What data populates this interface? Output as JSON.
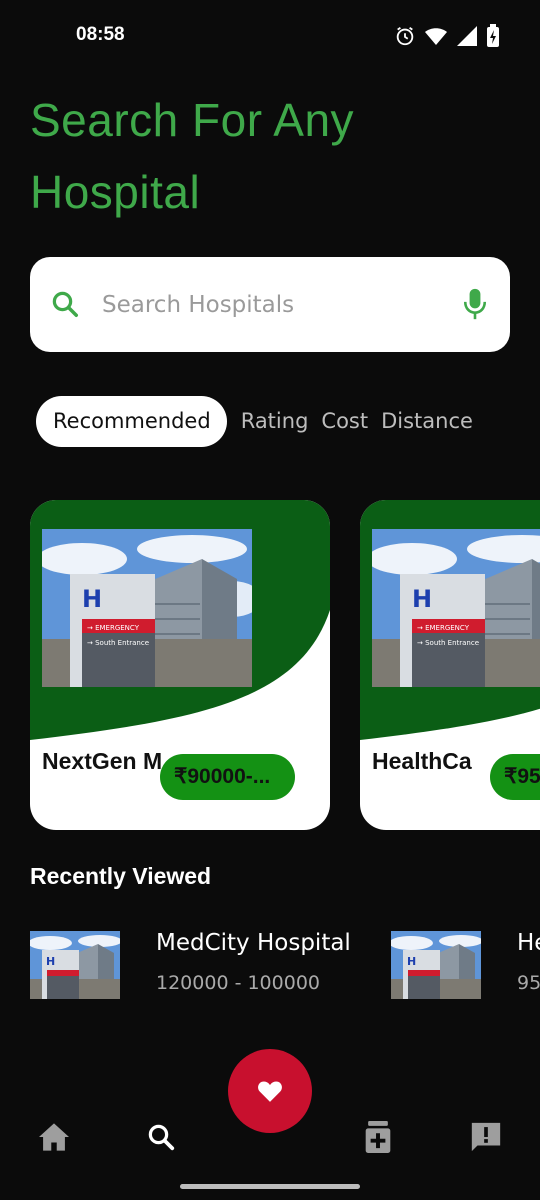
{
  "status_bar": {
    "time": "08:58"
  },
  "header": {
    "title": "Search For Any Hospital"
  },
  "search": {
    "placeholder": "Search Hospitals"
  },
  "tabs": [
    {
      "label": "Recommended",
      "active": true
    },
    {
      "label": "Rating",
      "active": false
    },
    {
      "label": "Cost",
      "active": false
    },
    {
      "label": "Distance",
      "active": false
    }
  ],
  "cards": [
    {
      "name": "NextGen M",
      "price": "₹90000-..."
    },
    {
      "name": "HealthCa",
      "price": "₹95"
    }
  ],
  "recently_viewed": {
    "title": "Recently Viewed",
    "items": [
      {
        "name": "MedCity Hospital",
        "range": "120000 - 100000"
      },
      {
        "name": "He",
        "range": "95"
      }
    ]
  },
  "colors": {
    "accent_green": "#3fa94a",
    "card_green": "#0b5e15",
    "price_green": "#149114",
    "fab_red": "#c8102e",
    "background": "#0b0b0b"
  },
  "icons": {
    "status": [
      "alarm-icon",
      "wifi-icon",
      "signal-icon",
      "battery-icon"
    ],
    "search": "search-icon",
    "mic": "mic-icon",
    "fab": "heart-icon",
    "nav": [
      "home-icon",
      "search-icon",
      "medicine-icon",
      "feedback-icon"
    ]
  }
}
